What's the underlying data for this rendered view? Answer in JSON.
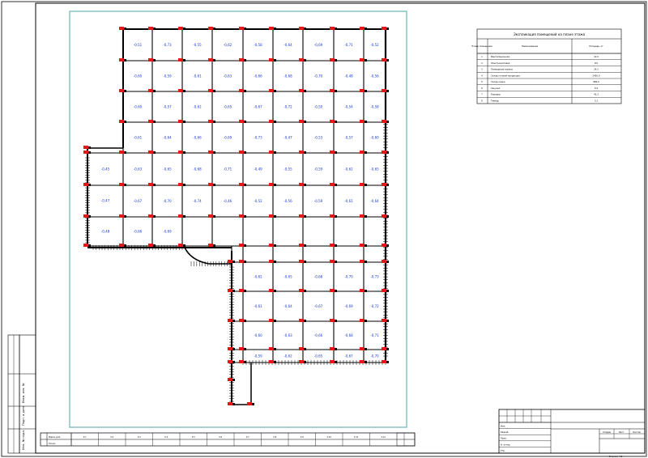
{
  "sheet": {
    "title_block_note": "Формат А1",
    "side_stamp_labels": [
      "Инв. № подл.",
      "Подп. и дата",
      "Взам. инв. №"
    ]
  },
  "legend": {
    "title": "Экспликация помещений на плане этажа",
    "headers": [
      "Номер помещения",
      "Наименование",
      "Площадь, м²"
    ],
    "rows": [
      {
        "num": "1",
        "name": "Вентиляционная",
        "area": "12,0"
      },
      {
        "num": "2",
        "name": "Электрощитовая",
        "area": "8,5"
      },
      {
        "num": "3",
        "name": "Помещение охраны",
        "area": "14,2"
      },
      {
        "num": "4",
        "name": "Склад готовой продукции",
        "area": "2450,0"
      },
      {
        "num": "5",
        "name": "Склад сырья",
        "area": "980,0"
      },
      {
        "num": "6",
        "name": "Санузел",
        "area": "6,4"
      },
      {
        "num": "7",
        "name": "Коридор",
        "area": "42,3"
      },
      {
        "num": "8",
        "name": "Тамбур",
        "area": "5,1"
      }
    ]
  },
  "bottom_table": {
    "row_labels": [
      "Марка узла",
      "Кол-во"
    ],
    "cells": [
      "У-1",
      "У-2",
      "У-3",
      "У-4",
      "У-5",
      "У-6",
      "У-7",
      "У-8",
      "У-9",
      "У-10",
      "У-11",
      "У-12"
    ]
  },
  "title_block": {
    "rows": [
      "Изм.",
      "Разраб.",
      "Пров.",
      "Н. контр.",
      "Утв."
    ],
    "stage_labels": [
      "Стадия",
      "Лист",
      "Листов"
    ],
    "format": "Формат А1"
  },
  "room_labels": [
    "-0,51",
    "-0,73",
    "-0,55",
    "-0,62",
    "-0,58",
    "-0,64",
    "-0,69",
    "-0,71",
    "-0,52",
    "-0,60",
    "-0,59",
    "-0,61",
    "-0,63",
    "-0,66",
    "-0,68",
    "-0,70",
    "-0,48",
    "-0,56",
    "-0,60",
    "-0,57",
    "-0,62",
    "-0,65",
    "-0,67",
    "-0,72",
    "-0,50",
    "-0,54",
    "-0,58",
    "-0,61",
    "-0,64",
    "-0,66",
    "-0,69",
    "-0,73",
    "-0,47",
    "-0,53",
    "-0,57",
    "-0,60",
    "-0,63",
    "-0,65",
    "-0,68",
    "-0,71",
    "-0,49",
    "-0,55",
    "-0,59",
    "-0,62",
    "-0,65",
    "-0,67",
    "-0,70",
    "-0,74",
    "-0,46",
    "-0,52",
    "-0,56",
    "-0,59",
    "-0,61",
    "-0,64",
    "-0,66",
    "-0,69"
  ],
  "annex_labels": [
    "-0,62",
    "-0,65",
    "-0,68",
    "-0,70",
    "-0,73",
    "-0,61",
    "-0,64",
    "-0,67",
    "-0,69",
    "-0,72",
    "-0,60",
    "-0,63",
    "-0,66",
    "-0,68",
    "-0,71",
    "-0,59",
    "-0,62",
    "-0,65",
    "-0,67",
    "-0,70"
  ],
  "wing_labels": [
    "-0,45",
    "-0,47",
    "-0,48"
  ]
}
